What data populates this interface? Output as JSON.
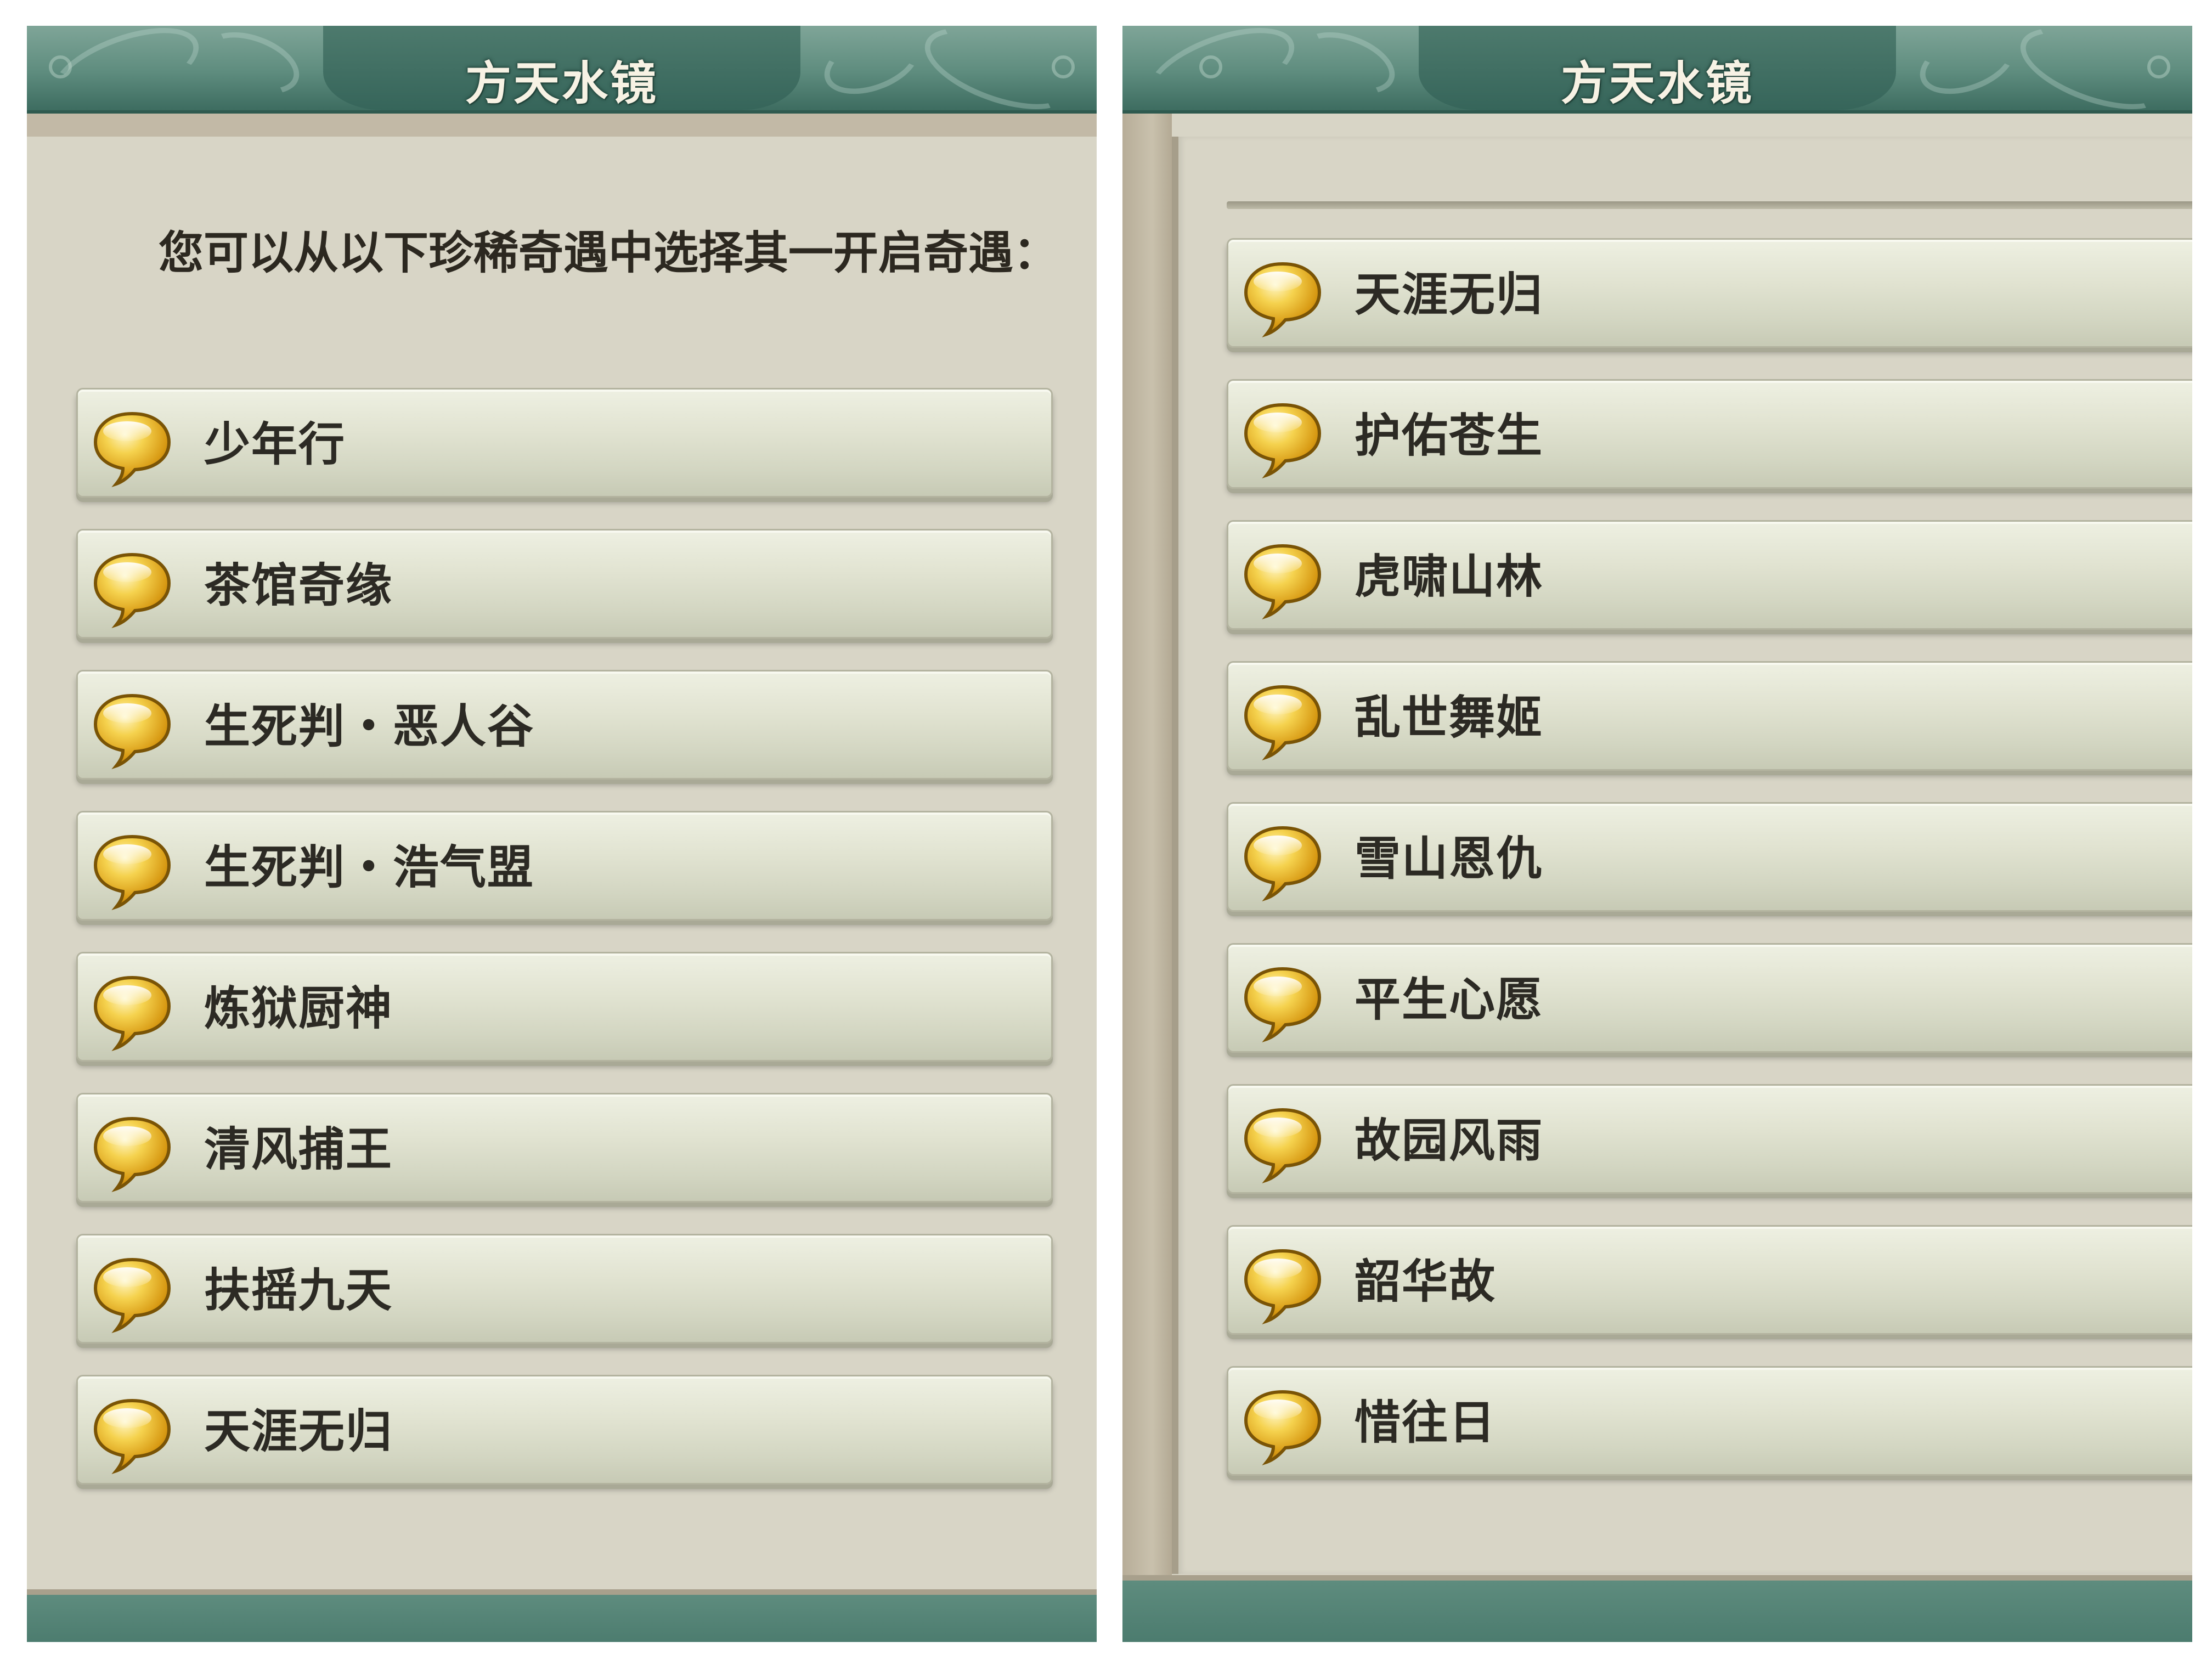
{
  "colors": {
    "panel_bg": "#d8d5c6",
    "title_bar": "#5e8c7e",
    "bubble_gold": "#e8b92c",
    "text_dark": "#2c2a24"
  },
  "left_panel": {
    "title": "方天水镜",
    "prompt": "您可以从以下珍稀奇遇中选择其一开启奇遇：",
    "options": [
      {
        "label": "少年行",
        "icon": "speech-bubble-icon"
      },
      {
        "label": "茶馆奇缘",
        "icon": "speech-bubble-icon"
      },
      {
        "label": "生死判・恶人谷",
        "icon": "speech-bubble-icon"
      },
      {
        "label": "生死判・浩气盟",
        "icon": "speech-bubble-icon"
      },
      {
        "label": "炼狱厨神",
        "icon": "speech-bubble-icon"
      },
      {
        "label": "清风捕王",
        "icon": "speech-bubble-icon"
      },
      {
        "label": "扶摇九天",
        "icon": "speech-bubble-icon"
      },
      {
        "label": "天涯无归",
        "icon": "speech-bubble-icon"
      }
    ]
  },
  "right_panel": {
    "title": "方天水镜",
    "options": [
      {
        "label": "天涯无归",
        "icon": "speech-bubble-icon"
      },
      {
        "label": "护佑苍生",
        "icon": "speech-bubble-icon"
      },
      {
        "label": "虎啸山林",
        "icon": "speech-bubble-icon"
      },
      {
        "label": "乱世舞姬",
        "icon": "speech-bubble-icon"
      },
      {
        "label": "雪山恩仇",
        "icon": "speech-bubble-icon"
      },
      {
        "label": "平生心愿",
        "icon": "speech-bubble-icon"
      },
      {
        "label": "故园风雨",
        "icon": "speech-bubble-icon"
      },
      {
        "label": "韶华故",
        "icon": "speech-bubble-icon"
      },
      {
        "label": "惜往日",
        "icon": "speech-bubble-icon"
      }
    ]
  }
}
